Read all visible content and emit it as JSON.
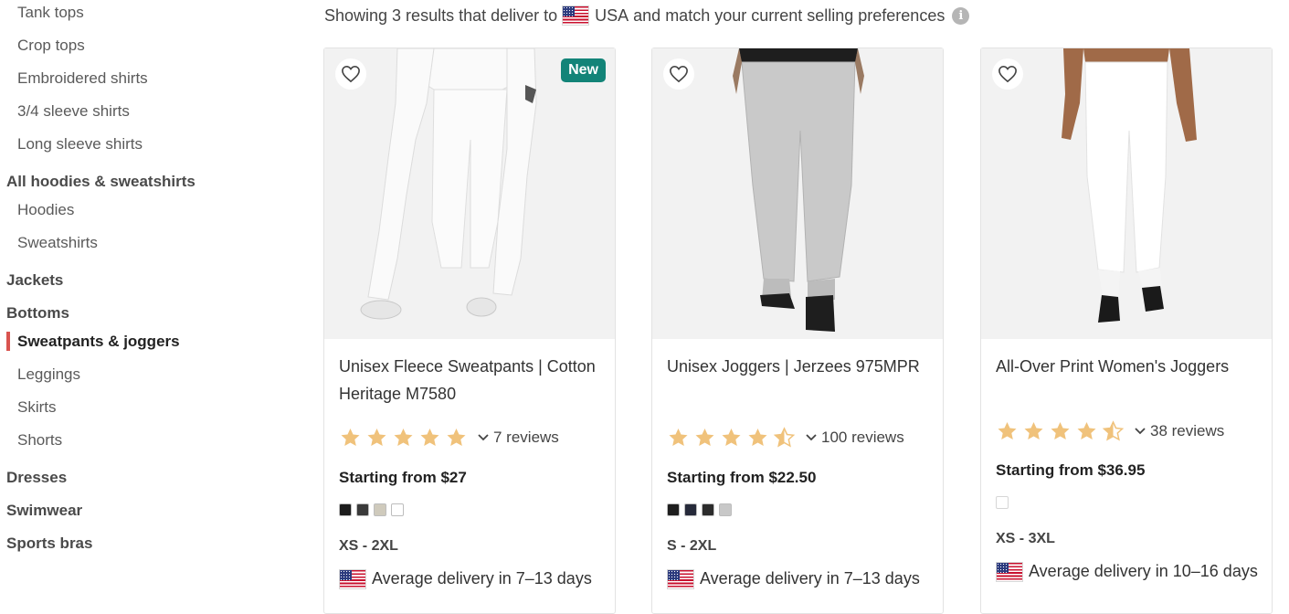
{
  "sidebar": {
    "items": [
      {
        "label": "Tank tops"
      },
      {
        "label": "Crop tops"
      },
      {
        "label": "Embroidered shirts"
      },
      {
        "label": "3/4 sleeve shirts"
      },
      {
        "label": "Long sleeve shirts"
      },
      {
        "label": "All hoodies & sweatshirts"
      },
      {
        "label": "Hoodies"
      },
      {
        "label": "Sweatshirts"
      },
      {
        "label": "Jackets"
      },
      {
        "label": "Bottoms"
      },
      {
        "label": "Sweatpants & joggers"
      },
      {
        "label": "Leggings"
      },
      {
        "label": "Skirts"
      },
      {
        "label": "Shorts"
      },
      {
        "label": "Dresses"
      },
      {
        "label": "Swimwear"
      },
      {
        "label": "Sports bras"
      }
    ],
    "active_label": "Sweatpants & joggers",
    "accent_color": "#d9534f"
  },
  "results": {
    "prefix": "Showing 3 results that deliver to",
    "country": "USA",
    "suffix": "and match your current selling preferences",
    "info_icon": "info-icon"
  },
  "products": [
    {
      "title": "Unisex Fleece Sweatpants | Cotton Heritage M7580",
      "badge": "New",
      "rating": 5,
      "reviews": "7 reviews",
      "price": "Starting from $27",
      "colors": [
        "#1c1c1c",
        "#3a3a3a",
        "#cfcabc",
        "#ffffff"
      ],
      "sizes": "XS - 2XL",
      "delivery": "Average delivery in 7–13 days"
    },
    {
      "title": "Unisex Joggers | Jerzees 975MPR",
      "rating": 4.5,
      "reviews": "100 reviews",
      "price": "Starting from $22.50",
      "colors": [
        "#1e1e1e",
        "#262a3a",
        "#2c2c2c",
        "#c8c8c8"
      ],
      "sizes": "S - 2XL",
      "delivery": "Average delivery in 7–13 days"
    },
    {
      "title": "All-Over Print Women's Joggers",
      "rating": 4.5,
      "reviews": "38 reviews",
      "price": "Starting from $36.95",
      "colors": [
        "#ffffff"
      ],
      "sizes": "XS - 3XL",
      "delivery": "Average delivery in 10–16 days"
    }
  ],
  "colors": {
    "star": "#f0c27b",
    "badge": "#138478"
  }
}
